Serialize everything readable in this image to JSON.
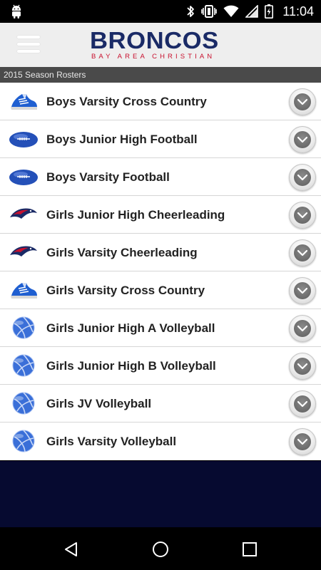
{
  "status_bar": {
    "time": "11:04",
    "icons": [
      "android-icon",
      "bluetooth-icon",
      "vibrate-icon",
      "wifi-icon",
      "signal-icon",
      "battery-icon"
    ]
  },
  "header": {
    "logo_main": "BRONCOS",
    "logo_sub": "BAY AREA CHRISTIAN",
    "brand_navy": "#1a2a66",
    "brand_red": "#c8102e"
  },
  "section": {
    "title": "2015 Season Rosters"
  },
  "rosters": [
    {
      "label": "Boys Varsity Cross Country",
      "icon": "running-shoe-icon"
    },
    {
      "label": "Boys Junior High Football",
      "icon": "football-icon"
    },
    {
      "label": "Boys Varsity Football",
      "icon": "football-icon"
    },
    {
      "label": "Girls Junior High Cheerleading",
      "icon": "bronco-logo-icon"
    },
    {
      "label": "Girls Varsity Cheerleading",
      "icon": "bronco-logo-icon"
    },
    {
      "label": "Girls Varsity Cross Country",
      "icon": "running-shoe-icon"
    },
    {
      "label": "Girls Junior High A Volleyball",
      "icon": "volleyball-icon"
    },
    {
      "label": "Girls Junior High B Volleyball",
      "icon": "volleyball-icon"
    },
    {
      "label": "Girls JV Volleyball",
      "icon": "volleyball-icon"
    },
    {
      "label": "Girls Varsity Volleyball",
      "icon": "volleyball-icon"
    }
  ],
  "nav_bar": {
    "buttons": [
      "back-icon",
      "home-icon",
      "recents-icon"
    ]
  }
}
